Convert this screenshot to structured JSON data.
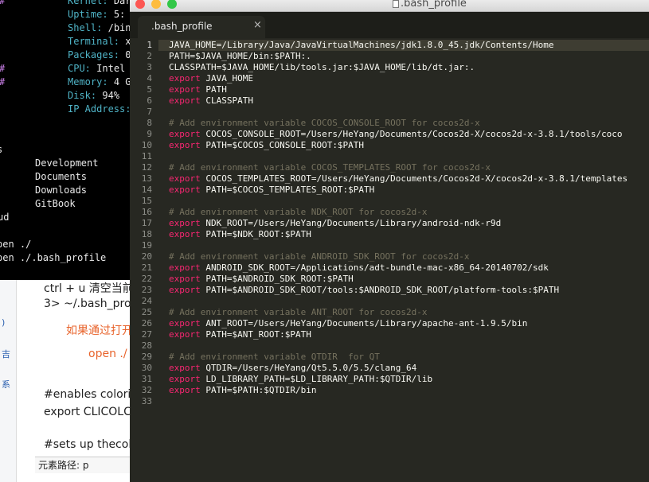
{
  "terminal": {
    "info": [
      {
        "label": "Kernel:",
        "value": "Dar",
        "hash": "#"
      },
      {
        "label": "Uptime:",
        "value": "5:",
        "hash": ""
      },
      {
        "label": "Shell:",
        "value": "/bin",
        "hash": ""
      },
      {
        "label": "Terminal:",
        "value": "x",
        "hash": ""
      },
      {
        "label": "Packages:",
        "value": "0",
        "hash": ""
      },
      {
        "label": "CPU:",
        "value": "Intel",
        "hash": "#"
      },
      {
        "label": "Memory:",
        "value": "4 G",
        "hash": "#"
      },
      {
        "label": "Disk:",
        "value": "94%",
        "hash": ""
      },
      {
        "label": "IP Address:",
        "value": "",
        "hash": ""
      }
    ],
    "stray_s": "s",
    "folders": [
      "Development",
      "Documents",
      "Downloads",
      "GitBook"
    ],
    "stray_ud": "ud",
    "commands": [
      "pen ./",
      "pen ./.bash_profile"
    ]
  },
  "doc": {
    "line1": "ctrl + u 清空当前",
    "line2": "3> ~/.bash_pro",
    "orange1": "如果通过打开",
    "orange2": "open ./",
    "line3": "#enables colori",
    "line4": "export CLICOLC",
    "line5": "#sets up thecol",
    "status_label": "元素路径: p",
    "sidebar_glyphs": [
      ")",
      "吉",
      "系"
    ]
  },
  "editor": {
    "window_title": ".bash_profile",
    "tab_label": ".bash_profile",
    "tab_close": "×",
    "current_line": 1,
    "lines": [
      {
        "n": "1",
        "kw": "",
        "text": "JAVA_HOME=/Library/Java/JavaVirtualMachines/jdk1.8.0_45.jdk/Contents/Home",
        "comment": false
      },
      {
        "n": "2",
        "kw": "",
        "text": "PATH=$JAVA_HOME/bin:$PATH:.",
        "comment": false
      },
      {
        "n": "3",
        "kw": "",
        "text": "CLASSPATH=$JAVA_HOME/lib/tools.jar:$JAVA_HOME/lib/dt.jar:.",
        "comment": false
      },
      {
        "n": "4",
        "kw": "export",
        "text": " JAVA_HOME",
        "comment": false
      },
      {
        "n": "5",
        "kw": "export",
        "text": " PATH",
        "comment": false
      },
      {
        "n": "6",
        "kw": "export",
        "text": " CLASSPATH",
        "comment": false
      },
      {
        "n": "7",
        "kw": "",
        "text": "",
        "comment": false
      },
      {
        "n": "8",
        "kw": "",
        "text": "# Add environment variable COCOS_CONSOLE_ROOT for cocos2d-x",
        "comment": true
      },
      {
        "n": "9",
        "kw": "export",
        "text": " COCOS_CONSOLE_ROOT=/Users/HeYang/Documents/Cocos2d-X/cocos2d-x-3.8.1/tools/coco",
        "comment": false
      },
      {
        "n": "10",
        "kw": "export",
        "text": " PATH=$COCOS_CONSOLE_ROOT:$PATH",
        "comment": false
      },
      {
        "n": "11",
        "kw": "",
        "text": "",
        "comment": false
      },
      {
        "n": "12",
        "kw": "",
        "text": "# Add environment variable COCOS_TEMPLATES_ROOT for cocos2d-x",
        "comment": true
      },
      {
        "n": "13",
        "kw": "export",
        "text": " COCOS_TEMPLATES_ROOT=/Users/HeYang/Documents/Cocos2d-X/cocos2d-x-3.8.1/templates",
        "comment": false
      },
      {
        "n": "14",
        "kw": "export",
        "text": " PATH=$COCOS_TEMPLATES_ROOT:$PATH",
        "comment": false
      },
      {
        "n": "15",
        "kw": "",
        "text": "",
        "comment": false
      },
      {
        "n": "16",
        "kw": "",
        "text": "# Add environment variable NDK_ROOT for cocos2d-x",
        "comment": true
      },
      {
        "n": "17",
        "kw": "export",
        "text": " NDK_ROOT=/Users/HeYang/Documents/Library/android-ndk-r9d",
        "comment": false
      },
      {
        "n": "18",
        "kw": "export",
        "text": " PATH=$NDK_ROOT:$PATH",
        "comment": false
      },
      {
        "n": "19",
        "kw": "",
        "text": "",
        "comment": false
      },
      {
        "n": "20",
        "kw": "",
        "text": "# Add environment variable ANDROID_SDK_ROOT for cocos2d-x",
        "comment": true
      },
      {
        "n": "21",
        "kw": "export",
        "text": " ANDROID_SDK_ROOT=/Applications/adt-bundle-mac-x86_64-20140702/sdk",
        "comment": false
      },
      {
        "n": "22",
        "kw": "export",
        "text": " PATH=$ANDROID_SDK_ROOT:$PATH",
        "comment": false
      },
      {
        "n": "23",
        "kw": "export",
        "text": " PATH=$ANDROID_SDK_ROOT/tools:$ANDROID_SDK_ROOT/platform-tools:$PATH",
        "comment": false
      },
      {
        "n": "24",
        "kw": "",
        "text": "",
        "comment": false
      },
      {
        "n": "25",
        "kw": "",
        "text": "# Add environment variable ANT_ROOT for cocos2d-x",
        "comment": true
      },
      {
        "n": "26",
        "kw": "export",
        "text": " ANT_ROOT=/Users/HeYang/Documents/Library/apache-ant-1.9.5/bin",
        "comment": false
      },
      {
        "n": "27",
        "kw": "export",
        "text": " PATH=$ANT_ROOT:$PATH",
        "comment": false
      },
      {
        "n": "28",
        "kw": "",
        "text": "",
        "comment": false
      },
      {
        "n": "29",
        "kw": "",
        "text": "# Add environment variable QTDIR  for QT",
        "comment": true
      },
      {
        "n": "30",
        "kw": "export",
        "text": " QTDIR=/Users/HeYang/Qt5.5.0/5.5/clang_64",
        "comment": false
      },
      {
        "n": "31",
        "kw": "export",
        "text": " LD_LIBRARY_PATH=$LD_LIBRARY_PATH:$QTDIR/lib",
        "comment": false
      },
      {
        "n": "32",
        "kw": "export",
        "text": " PATH=$PATH:$QTDIR/bin",
        "comment": false
      },
      {
        "n": "33",
        "kw": "",
        "text": "",
        "comment": false
      }
    ]
  },
  "colors": {
    "editor_bg": "#272822",
    "keyword": "#f92672",
    "comment": "#75715e",
    "terminal_label": "#4fb3c6",
    "terminal_hash": "#c87ee6",
    "close_light": "#fc5753",
    "minimize_light": "#fdbc40",
    "zoom_light": "#33c748"
  }
}
